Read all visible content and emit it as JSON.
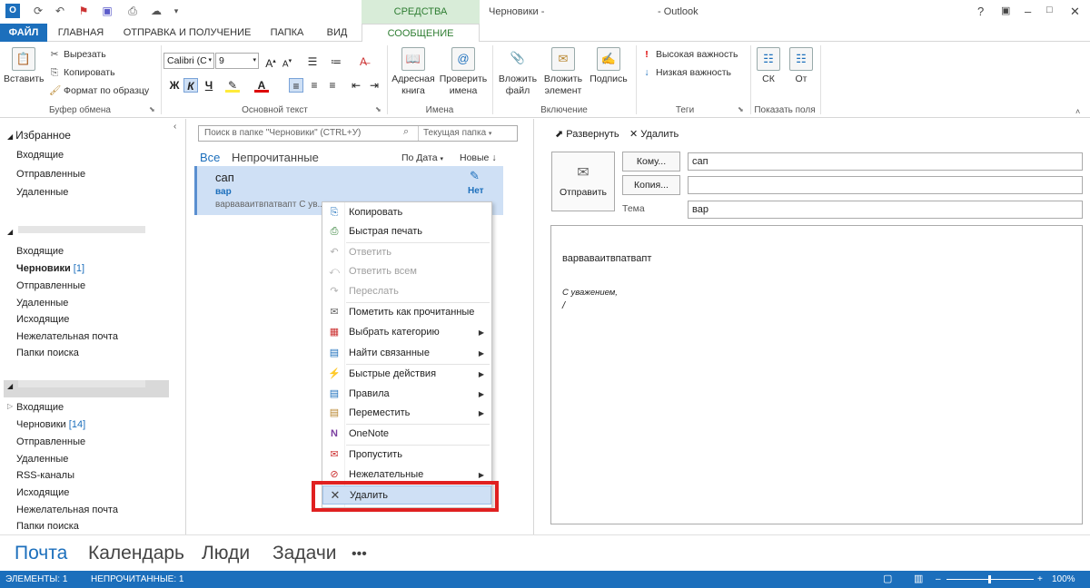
{
  "titlebar": {
    "context_tab": "СРЕДСТВА СОСТАВЛЕНИЯ",
    "doc_title": "Черновики -",
    "app_name": "- Outlook",
    "help": "?"
  },
  "tabs": [
    {
      "label": "ФАЙЛ"
    },
    {
      "label": "ГЛАВНАЯ"
    },
    {
      "label": "ОТПРАВКА И ПОЛУЧЕНИЕ"
    },
    {
      "label": "ПАПКА"
    },
    {
      "label": "ВИД"
    },
    {
      "label": "СООБЩЕНИЕ"
    }
  ],
  "ribbon": {
    "clipboard": {
      "paste": "Вставить",
      "cut": "Вырезать",
      "copy": "Копировать",
      "format_painter": "Формат по образцу",
      "group": "Буфер обмена"
    },
    "font": {
      "family": "Calibri (С",
      "size": "9",
      "group": "Основной текст",
      "bold": "Ж",
      "italic": "К",
      "underline": "Ч"
    },
    "names": {
      "address_book_1": "Адресная",
      "address_book_2": "книга",
      "check_names_1": "Проверить",
      "check_names_2": "имена",
      "group": "Имена"
    },
    "include": {
      "attach_file_1": "Вложить",
      "attach_file_2": "файл",
      "attach_item_1": "Вложить",
      "attach_item_2": "элемент",
      "signature": "Подпись",
      "group": "Включение"
    },
    "tags": {
      "high": "Высокая важность",
      "low": "Низкая важность",
      "group": "Теги"
    },
    "fields": {
      "bcc": "СК",
      "from": "От",
      "group": "Показать поля"
    }
  },
  "nav": {
    "favorites_head": "Избранное",
    "favorites": [
      "Входящие",
      "Отправленные",
      "Удаленные"
    ],
    "account1": [
      {
        "label": "Входящие",
        "count": ""
      },
      {
        "label": "Черновики",
        "count": "[1]"
      },
      {
        "label": "Отправленные",
        "count": ""
      },
      {
        "label": "Удаленные",
        "count": ""
      },
      {
        "label": "Исходящие",
        "count": ""
      },
      {
        "label": "Нежелательная почта",
        "count": ""
      },
      {
        "label": "Папки поиска",
        "count": ""
      }
    ],
    "account2": [
      {
        "label": "Входящие",
        "count": ""
      },
      {
        "label": "Черновики",
        "count": "[14]"
      },
      {
        "label": "Отправленные",
        "count": ""
      },
      {
        "label": "Удаленные",
        "count": ""
      },
      {
        "label": "RSS-каналы",
        "count": ""
      },
      {
        "label": "Исходящие",
        "count": ""
      },
      {
        "label": "Нежелательная почта",
        "count": ""
      },
      {
        "label": "Папки поиска",
        "count": ""
      }
    ]
  },
  "list": {
    "search_placeholder": "Поиск в папке \"Черновики\" (CTRL+У)",
    "scope": "Текущая папка",
    "filter_all": "Все",
    "filter_unread": "Непрочитанные",
    "sort_by": "По Дата",
    "sort_order": "Новые",
    "message": {
      "from": "сап",
      "subject": "вар",
      "preview": "варваваитвпатвапт  С ув...",
      "status": "Нет"
    }
  },
  "context_menu": [
    {
      "label": "Копировать",
      "icon": "copy-icon",
      "disabled": false,
      "submenu": false
    },
    {
      "label": "Быстрая печать",
      "icon": "printer-icon",
      "disabled": false,
      "submenu": false
    },
    {
      "label": "Ответить",
      "icon": "reply-icon",
      "disabled": true,
      "submenu": false
    },
    {
      "label": "Ответить всем",
      "icon": "reply-all-icon",
      "disabled": true,
      "submenu": false
    },
    {
      "label": "Переслать",
      "icon": "forward-icon",
      "disabled": true,
      "submenu": false
    },
    {
      "label": "Пометить как прочитанные",
      "icon": "envelope-open-icon",
      "disabled": false,
      "submenu": false
    },
    {
      "label": "Выбрать категорию",
      "icon": "category-icon",
      "disabled": false,
      "submenu": true
    },
    {
      "label": "Найти связанные",
      "icon": "find-related-icon",
      "disabled": false,
      "submenu": true
    },
    {
      "label": "Быстрые действия",
      "icon": "lightning-icon",
      "disabled": false,
      "submenu": true
    },
    {
      "label": "Правила",
      "icon": "rules-icon",
      "disabled": false,
      "submenu": true
    },
    {
      "label": "Переместить",
      "icon": "move-icon",
      "disabled": false,
      "submenu": true
    },
    {
      "label": "OneNote",
      "icon": "onenote-icon",
      "disabled": false,
      "submenu": false
    },
    {
      "label": "Пропустить",
      "icon": "ignore-icon",
      "disabled": false,
      "submenu": false
    },
    {
      "label": "Нежелательные",
      "icon": "junk-icon",
      "disabled": false,
      "submenu": true
    },
    {
      "label": "Удалить",
      "icon": "delete-icon",
      "disabled": false,
      "submenu": false
    }
  ],
  "reading": {
    "expand": "Развернуть",
    "delete": "Удалить",
    "send": "Отправить",
    "to_btn": "Кому...",
    "cc_btn": "Копия...",
    "subject_label": "Тема",
    "to_value": "сап",
    "cc_value": "",
    "subject_value": "вар",
    "body_line1": "варваваитвпатвапт",
    "body_sign": "С уважением,",
    "body_cursor": "/"
  },
  "bottom_nav": [
    "Почта",
    "Календарь",
    "Люди",
    "Задачи",
    "•••"
  ],
  "status": {
    "items": "ЭЛЕМЕНТЫ: 1",
    "unread": "НЕПРОЧИТАННЫЕ: 1",
    "zoom": "100%"
  },
  "colors": {
    "accent": "#1c6fbc",
    "context_tab": "#2e7d32",
    "highlight": "#e02020"
  }
}
